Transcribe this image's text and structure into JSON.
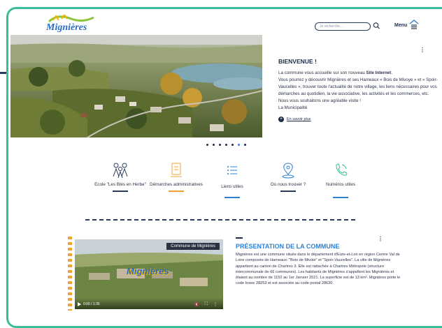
{
  "header": {
    "logo_text": "Mignières",
    "search_placeholder": "Je recherche...",
    "menu_label": "Menu"
  },
  "welcome": {
    "title": "BIENVENUE !",
    "p1_before": "La commune vous accueille sur son nouveau ",
    "p1_bold": "Site Internet",
    "p1_after": ".",
    "p2": "Vous pourrez y découvrir Mignières et ses Hameaux « Bois de Mivoye » et « Spoir-Vaucelles », trouver toute l'actualité de notre village, les liens nécessaires pour vos démarches au quotidien, la vie associative, les activités et les commerces, etc.",
    "p3": "Nous vous souhaitons une agréable visite !",
    "p4": "La Municipalité",
    "more_label": "En savoir plus"
  },
  "carousel": {
    "count": 7,
    "active": 5
  },
  "quick_links": [
    {
      "label": "Ecole \"Les Blés en Herbe\"",
      "icon": "children-icon",
      "bar": "#2a3a5a"
    },
    {
      "label": "Démarches administratives",
      "icon": "document-icon",
      "bar": "#f0a030"
    },
    {
      "label": "Liens utiles",
      "icon": "list-icon",
      "bar": "#2f7fd1"
    },
    {
      "label": "Où nous trouver ?",
      "icon": "map-pin-icon",
      "bar": "#2a3a5a"
    },
    {
      "label": "Numéros utiles",
      "icon": "phone-icon",
      "bar": "#2f7fd1"
    }
  ],
  "video": {
    "tag": "Commune de Mignières",
    "time": "0:00 / 1:35",
    "overlay_logo": "Mignières"
  },
  "presentation": {
    "title": "PRÉSENTATION DE LA COMMUNE",
    "body": "Mignières est une commune située dans le département d'Eure-et-Loir en région Centre Val de Loire composée de Hameaux: \"Bois de Mivoie\" et \"Spoir-Vaucelles\". La ville de Mignières appartient au canton de Chartres 3. Elle est rattachée à Chartres Métropole (structure intercommunale de 66 communes). Les habitants de Mignières s'appellent les Migniérois et étaient au nombre de 1152 au 1er Janvier 2021. La superficie est de 13 km². Mignières porte le code Insee 28253 et est associée au code postal 28630."
  },
  "colors": {
    "accent": "#3bbf9a",
    "navy": "#1d2b48",
    "orange": "#f0a030",
    "blue": "#2f7fd1"
  }
}
